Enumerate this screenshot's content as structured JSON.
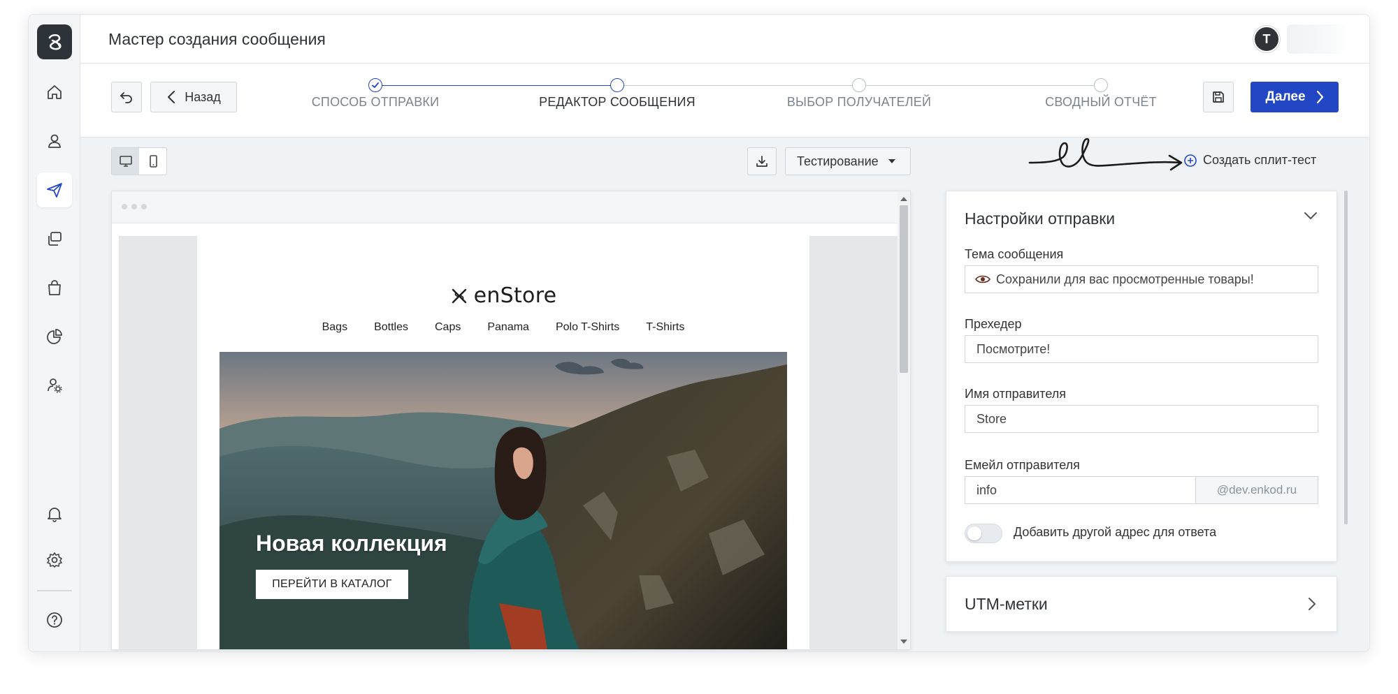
{
  "header": {
    "title": "Мастер создания сообщения",
    "avatar_initial": "T"
  },
  "sidebar": {
    "items": [
      {
        "name": "home",
        "icon": "home-icon"
      },
      {
        "name": "contacts",
        "icon": "user-icon"
      },
      {
        "name": "messages",
        "icon": "send-icon",
        "active": true
      },
      {
        "name": "templates",
        "icon": "copy-icon"
      },
      {
        "name": "shop",
        "icon": "bag-icon"
      },
      {
        "name": "analytics",
        "icon": "pie-chart-icon"
      },
      {
        "name": "user-settings",
        "icon": "user-gear-icon"
      },
      {
        "name": "notifications",
        "icon": "bell-icon"
      },
      {
        "name": "settings",
        "icon": "gear-icon"
      },
      {
        "name": "help",
        "icon": "help-icon"
      }
    ]
  },
  "wizard": {
    "back_label": "Назад",
    "next_label": "Далее",
    "steps": [
      {
        "label": "СПОСОБ ОТПРАВКИ",
        "state": "done"
      },
      {
        "label": "РЕДАКТОР СООБЩЕНИЯ",
        "state": "current"
      },
      {
        "label": "ВЫБОР ПОЛУЧАТЕЛЕЙ",
        "state": "todo"
      },
      {
        "label": "СВОДНЫЙ ОТЧЁТ",
        "state": "todo"
      }
    ]
  },
  "toolbar": {
    "testing_label": "Тестирование",
    "split_test_label": "Создать сплит-тест"
  },
  "email": {
    "brand": "enStore",
    "nav": [
      "Bags",
      "Bottles",
      "Caps",
      "Panama",
      "Polo T-Shirts",
      "T-Shirts"
    ],
    "hero_title": "Новая коллекция",
    "hero_button": "ПЕРЕЙТИ В КАТАЛОГ"
  },
  "settings": {
    "title": "Настройки отправки",
    "subject_label": "Тема сообщения",
    "subject_value": "Сохранили для вас просмотренные товары!",
    "preheader_label": "Прехедер",
    "preheader_value": "Посмотрите!",
    "sender_name_label": "Имя отправителя",
    "sender_name_value": "Store",
    "sender_email_label": "Емейл отправителя",
    "sender_email_local": "info",
    "sender_email_domain": "@dev.enkod.ru",
    "reply_toggle_label": "Добавить другой адрес для ответа",
    "reply_toggle_on": false
  },
  "utm": {
    "title": "UTM-метки"
  },
  "colors": {
    "accent": "#2346c4",
    "sidebar_bg": "#f3f5f7",
    "page_bg": "#f0f3f6"
  }
}
